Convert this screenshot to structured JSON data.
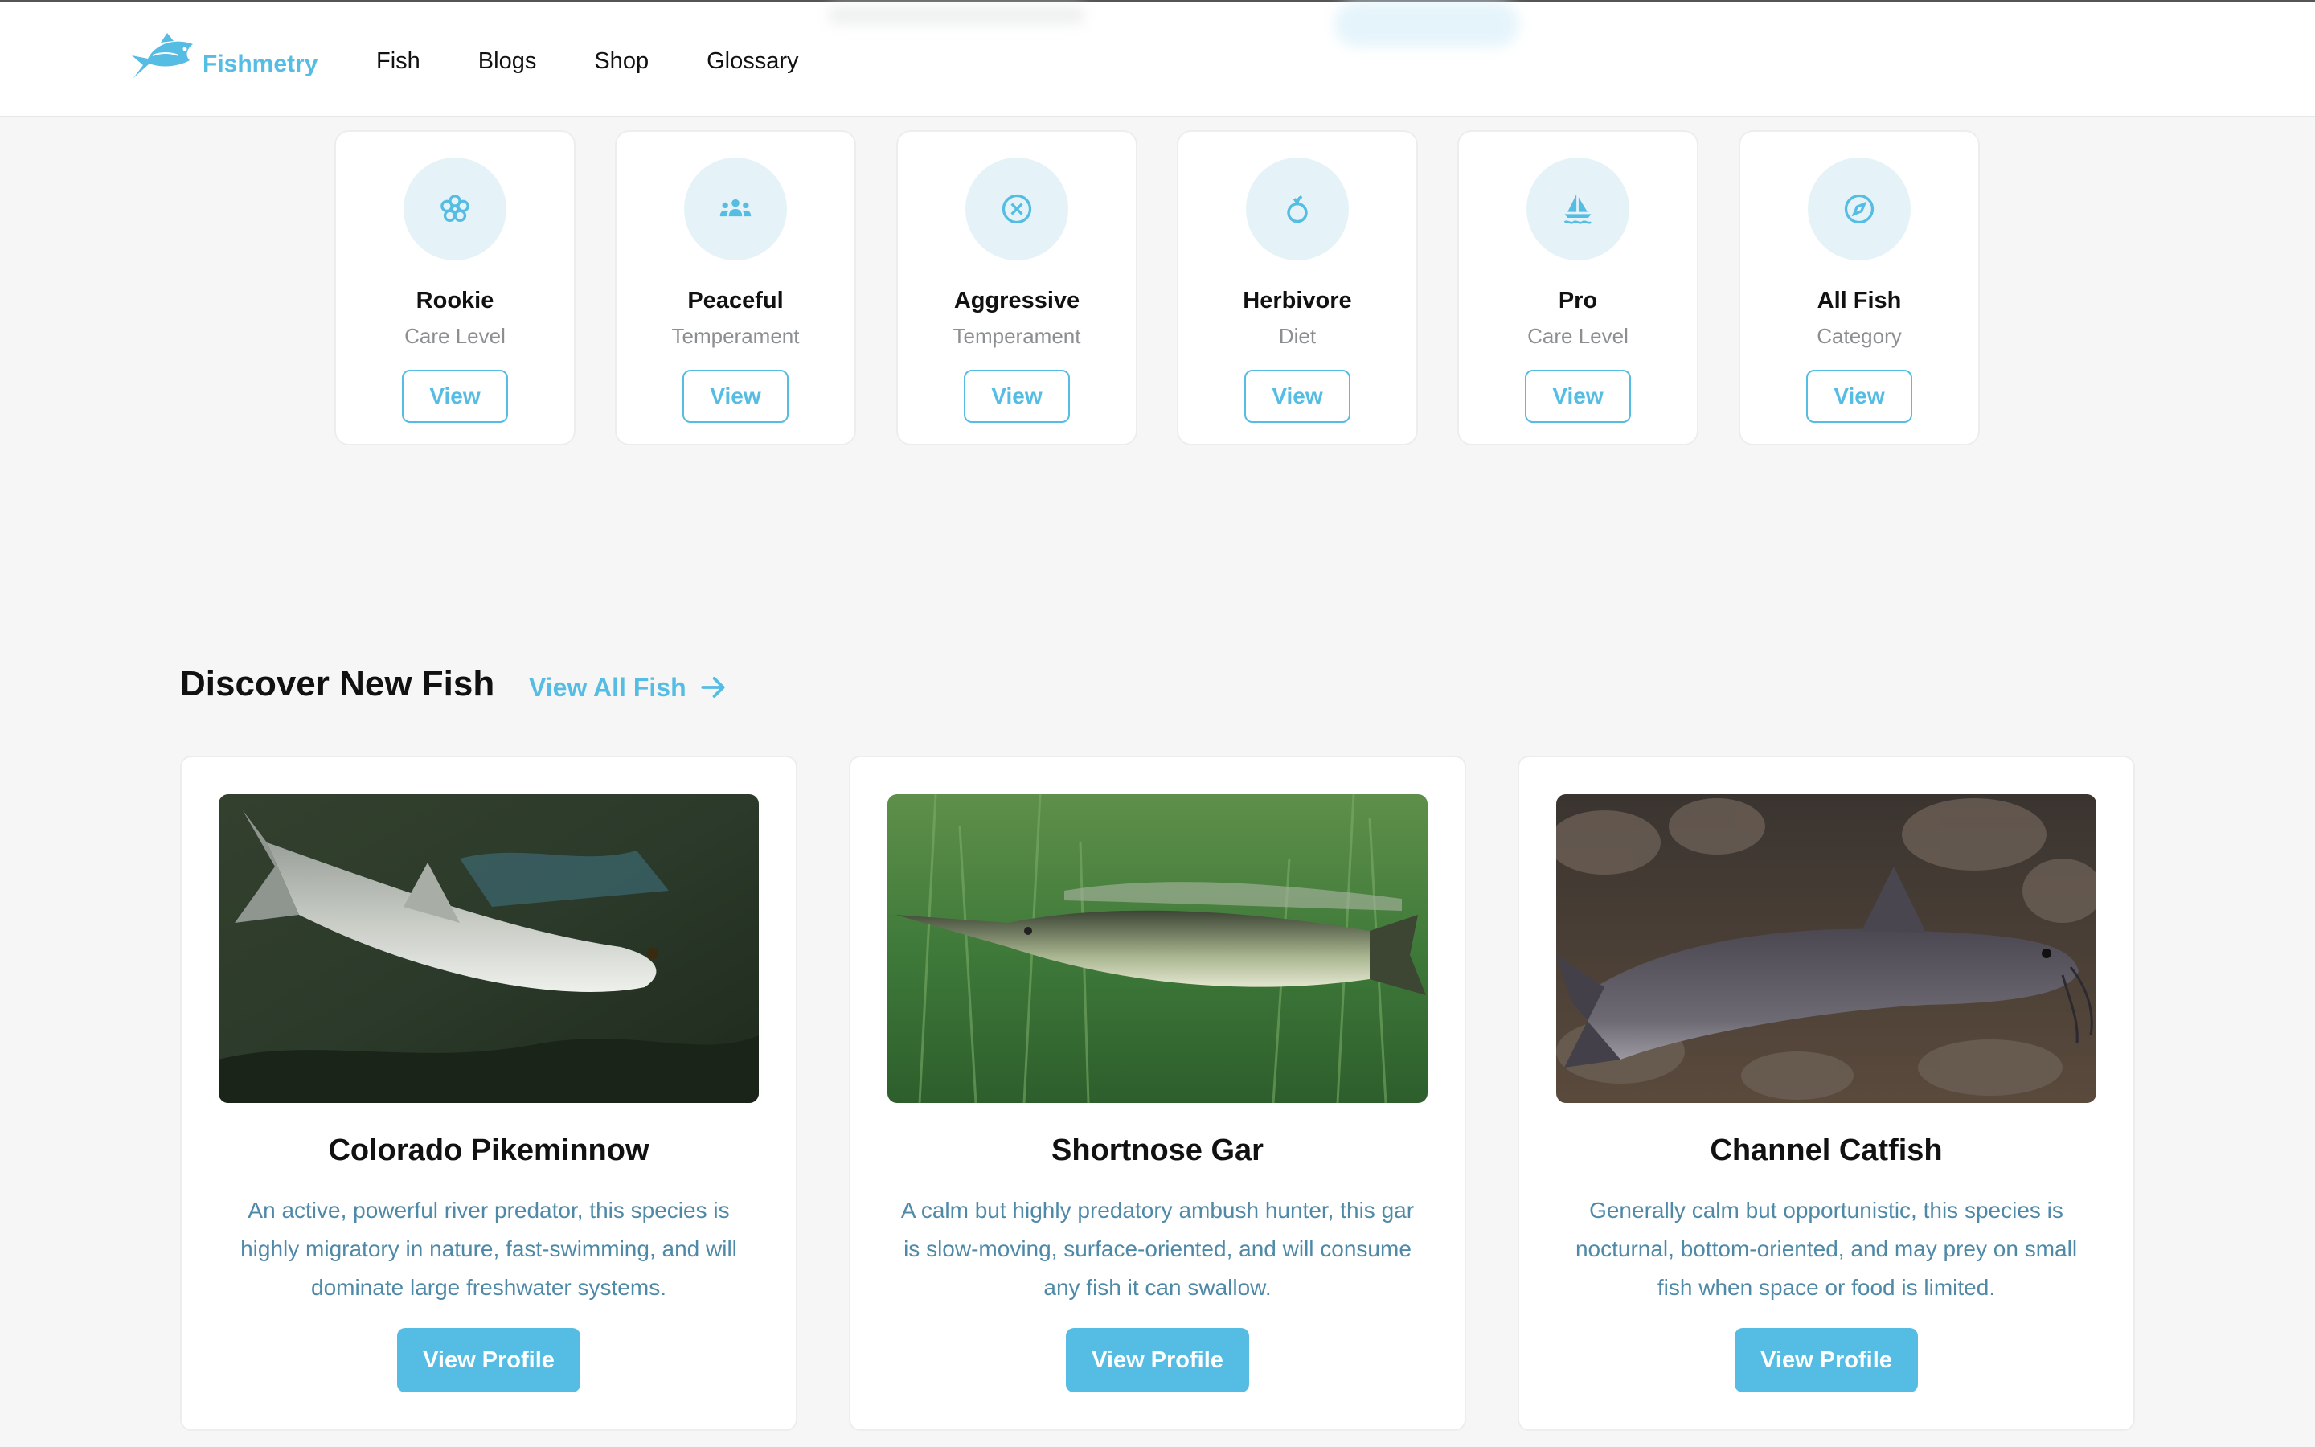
{
  "brand": {
    "name": "Fishmetry"
  },
  "nav": {
    "items": [
      "Fish",
      "Blogs",
      "Shop",
      "Glossary"
    ]
  },
  "categories": [
    {
      "title": "Rookie",
      "subtitle": "Care Level",
      "button": "View",
      "icon": "flower-icon"
    },
    {
      "title": "Peaceful",
      "subtitle": "Temperament",
      "button": "View",
      "icon": "group-icon"
    },
    {
      "title": "Aggressive",
      "subtitle": "Temperament",
      "button": "View",
      "icon": "x-circle-icon"
    },
    {
      "title": "Herbivore",
      "subtitle": "Diet",
      "button": "View",
      "icon": "apple-icon"
    },
    {
      "title": "Pro",
      "subtitle": "Care Level",
      "button": "View",
      "icon": "sailboat-icon"
    },
    {
      "title": "All Fish",
      "subtitle": "Category",
      "button": "View",
      "icon": "compass-icon"
    }
  ],
  "discover": {
    "title": "Discover New Fish",
    "view_all": "View All Fish",
    "fish": [
      {
        "name": "Colorado Pikeminnow",
        "description": "An active, powerful river predator, this species is highly migratory in nature, fast-swimming, and will dominate large freshwater systems.",
        "button": "View Profile"
      },
      {
        "name": "Shortnose Gar",
        "description": "A calm but highly predatory ambush hunter, this gar is slow-moving, surface-oriented, and will consume any fish it can swallow.",
        "button": "View Profile"
      },
      {
        "name": "Channel Catfish",
        "description": "Generally calm but opportunistic, this species is nocturnal, bottom-oriented, and may prey on small fish when space or food is limited.",
        "button": "View Profile"
      }
    ]
  },
  "colors": {
    "accent": "#55bde3",
    "desc_text": "#4e8aa8",
    "icon_bg": "#e5f3f8",
    "page_bg": "#f5f6f5"
  }
}
